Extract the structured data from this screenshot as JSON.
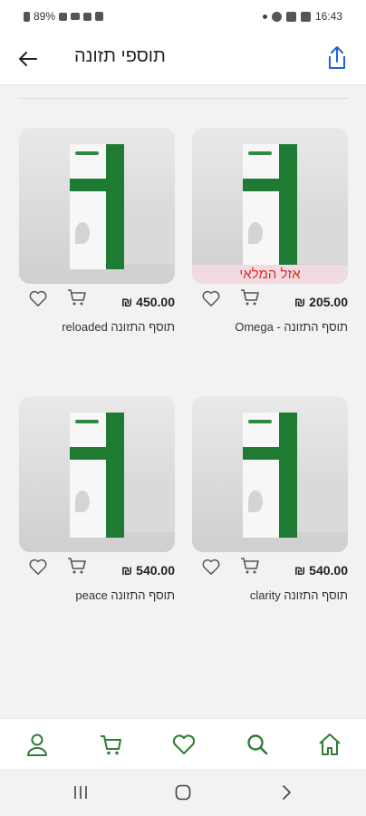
{
  "status_bar": {
    "battery": "89%",
    "time": "16:43"
  },
  "app_bar": {
    "title": "תוספי תזונה",
    "back_icon": "arrow-left-icon",
    "share_icon": "share-icon"
  },
  "products": [
    {
      "name": "תוסף התזונה - Omega",
      "price": "205.00 ₪",
      "sold_out": "אזל המלאי"
    },
    {
      "name": "תוסף התזונה reloaded",
      "price": "450.00 ₪"
    },
    {
      "name": "תוסף התזונה clarity",
      "price": "540.00 ₪"
    },
    {
      "name": "תוסף התזונה peace",
      "price": "540.00 ₪"
    }
  ],
  "bottom_nav": [
    "profile-icon",
    "cart-icon",
    "heart-icon",
    "search-icon",
    "home-icon"
  ],
  "colors": {
    "accent": "#1f7a33",
    "sold_out_text": "#d32f2f",
    "sold_out_bg": "#f2dbe0"
  }
}
